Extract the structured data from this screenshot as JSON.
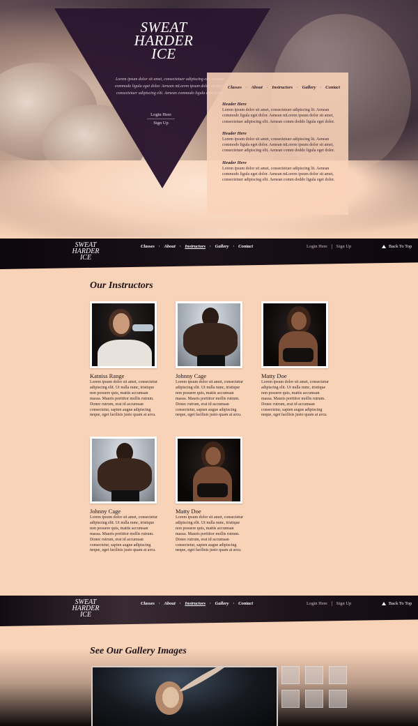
{
  "brand": {
    "line1": "SWEAT",
    "line2": "HARDER",
    "line3": "ICE"
  },
  "hero": {
    "intro": "Lorem ipsum dolor sit amet, consectetuer adipiscing elit. Aenean commodo ligula eget dolor. Aenean mLorem ipsum dolor sit amet, consectetuer adipiscing elit. Aenean commodo ligula eget dolor.",
    "login": "Login Here",
    "signup": "Sign Up"
  },
  "side_nav": [
    "Classes",
    "About",
    "Instructors",
    "Gallery",
    "Contact"
  ],
  "side_articles": [
    {
      "heading": "Header Here",
      "body": "Lorem ipsum dolor sit amet, consectetuer adipiscing lit. Aenean commodo ligula eget dolor. Aenean mLorem ipsum dolor sit amet, consectetuer adipiscing elit. Aenean comm doddo ligula eget dolor."
    },
    {
      "heading": "Header Here",
      "body": "Lorem ipsum dolor sit amet, consectetuer adipiscing lit. Aenean commodo ligula eget dolor. Aenean mLorem ipsum dolor sit amet, consectetuer adipiscing elit. Aenean comm doddo ligula eget dolor."
    },
    {
      "heading": "Header Here",
      "body": "Lorem ipsum dolor sit amet, consectetuer adipiscing lit. Aenean commodo ligula eget dolor. Aenean mLorem ipsum dolor sit amet, consectetuer adipiscing elit. Aenean comm doddo ligula eget dolor."
    }
  ],
  "navbar": {
    "logo": {
      "line1": "SWEAT",
      "line2": "HARDER",
      "line3": "ICE"
    },
    "links": [
      "Classes",
      "About",
      "Instructors",
      "Gallery",
      "Contact"
    ],
    "active": "Instructors",
    "login": "Login Here",
    "signup": "Sign Up",
    "back_to_top": "Back To Top"
  },
  "instructors": {
    "title": "Our Instructors",
    "items": [
      {
        "name": "Katniss Range",
        "bio": "Lorem ipsum dolor sit amet, consectetur adipiscing elit. Ut nulla nunc, tristique non posuere quis, mattis accumsan massa. Mauris porttitor mollis rutrum. Donec rutrum, erat id accumsan consectetur, sapien augue adipiscing neque, eget facilisis justo quam at arcu."
      },
      {
        "name": "Johnny Cage",
        "bio": "Lorem ipsum dolor sit amet, consectetur adipiscing elit. Ut nulla nunc, tristique non posuere quis, mattis accumsan massa. Mauris porttitor mollis rutrum. Donec rutrum, erat id accumsan consectetur, sapien augue adipiscing neque, eget facilisis justo quam at arcu."
      },
      {
        "name": "Matty Doe",
        "bio": "Lorem ipsum dolor sit amet, consectetur adipiscing elit. Ut nulla nunc, tristique non posuere quis, mattis accumsan massa. Mauris porttitor mollis rutrum. Donec rutrum, erat id accumsan consectetur, sapien augue adipiscing neque, eget facilisis justo quam at arcu."
      },
      {
        "name": "Johnny Cage",
        "bio": "Lorem ipsum dolor sit amet, consectetur adipiscing elit. Ut nulla nunc, tristique non posuere quis, mattis accumsan massa. Mauris porttitor mollis rutrum. Donec rutrum, erat id accumsan consectetur, sapien augue adipiscing neque, eget facilisis justo quam at arcu."
      },
      {
        "name": "Matty Doe",
        "bio": "Lorem ipsum dolor sit amet, consectetur adipiscing elit. Ut nulla nunc, tristique non posuere quis, mattis accumsan massa. Mauris porttitor mollis rutrum. Donec rutrum, erat id accumsan consectetur, sapien augue adipiscing neque, eget facilisis justo quam at arcu."
      }
    ]
  },
  "gallery": {
    "title": "See Our Gallery Images"
  },
  "colors": {
    "background": "#f9d3b8",
    "navbar": "#0c070b",
    "triangle": "#2a1630",
    "text": "#1c1316"
  }
}
